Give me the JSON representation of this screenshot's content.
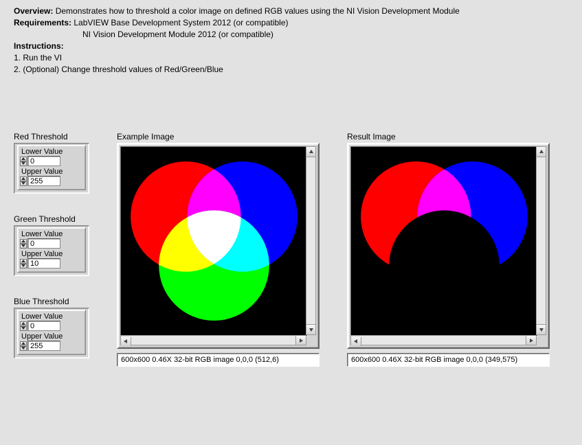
{
  "overview_label": "Overview:",
  "overview_text": " Demonstrates how to threshold a color image on defined RGB values using the NI Vision Development Module",
  "requirements_label": "Requirements:",
  "requirements_text1": " LabVIEW Base Development System 2012 (or compatible)",
  "requirements_text2": "NI Vision Development Module 2012 (or compatible)",
  "instructions_label": "Instructions:",
  "instructions_items": [
    "1. Run the VI",
    "2. (Optional) Change threshold values of Red/Green/Blue"
  ],
  "thresholds": {
    "red": {
      "title": "Red Threshold",
      "lower_label": "Lower Value",
      "lower_value": "0",
      "upper_label": "Upper Value",
      "upper_value": "255"
    },
    "green": {
      "title": "Green Threshold",
      "lower_label": "Lower Value",
      "lower_value": "0",
      "upper_label": "Upper Value",
      "upper_value": "10"
    },
    "blue": {
      "title": "Blue Threshold",
      "lower_label": "Lower Value",
      "lower_value": "0",
      "upper_label": "Upper Value",
      "upper_value": "255"
    }
  },
  "example_image": {
    "title": "Example Image",
    "status": "600x600 0.46X 32-bit RGB image 0,0,0    (512,6)"
  },
  "result_image": {
    "title": "Result Image",
    "status": "600x600 0.46X 32-bit RGB image 0,0,0    (349,575)"
  },
  "colors": {
    "red": "#ff0000",
    "green": "#00ff00",
    "blue": "#0000ff",
    "yellow": "#ffff00",
    "cyan": "#00ffff",
    "magenta": "#ff00ff",
    "white": "#ffffff",
    "black": "#000000"
  }
}
